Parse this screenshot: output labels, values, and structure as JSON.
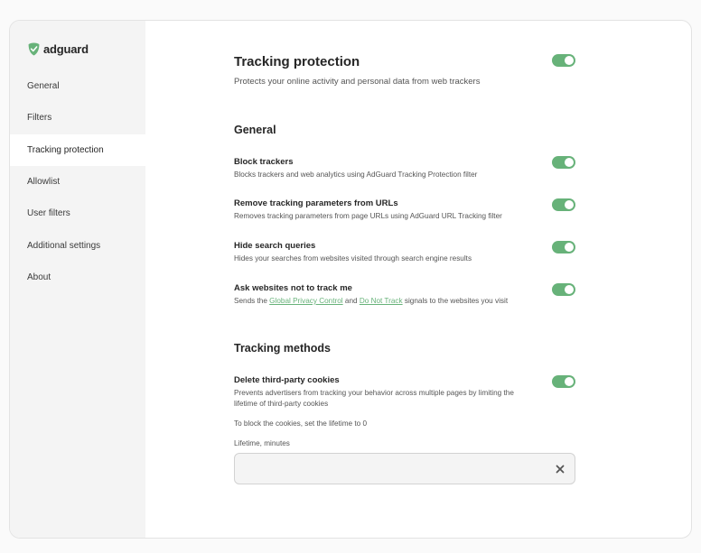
{
  "app": {
    "logo_text": "adguard",
    "accent_color": "#67b279",
    "logo_icon": "shield-check-icon"
  },
  "sidebar": {
    "items": [
      {
        "label": "General"
      },
      {
        "label": "Filters"
      },
      {
        "label": "Tracking protection",
        "active": true
      },
      {
        "label": "Allowlist"
      },
      {
        "label": "User filters"
      },
      {
        "label": "Additional settings"
      },
      {
        "label": "About"
      }
    ]
  },
  "page": {
    "title": "Tracking protection",
    "subtitle": "Protects your online activity and personal data from web trackers",
    "enabled": true
  },
  "general": {
    "title": "General",
    "settings": [
      {
        "title": "Block trackers",
        "description": "Blocks trackers and web analytics using AdGuard Tracking Protection filter",
        "enabled": true
      },
      {
        "title": "Remove tracking parameters from URLs",
        "description": "Removes tracking parameters from page URLs using AdGuard URL Tracking filter",
        "enabled": true
      },
      {
        "title": "Hide search queries",
        "description": "Hides your searches from websites visited through search engine results",
        "enabled": true
      },
      {
        "title": "Ask websites not to track me",
        "description_prefix": "Sends the ",
        "link1": "Global Privacy Control",
        "description_mid": " and ",
        "link2": "Do Not Track",
        "description_suffix": " signals to the websites you visit",
        "enabled": true
      }
    ]
  },
  "methods": {
    "title": "Tracking methods",
    "settings": [
      {
        "title": "Delete third-party cookies",
        "description": "Prevents advertisers from tracking your behavior across multiple pages by limiting the lifetime of third-party cookies",
        "enabled": true
      }
    ],
    "hint": "To block the cookies, set the lifetime to 0",
    "field_label": "Lifetime, minutes",
    "field_value": "",
    "clear_icon": "close-icon"
  }
}
